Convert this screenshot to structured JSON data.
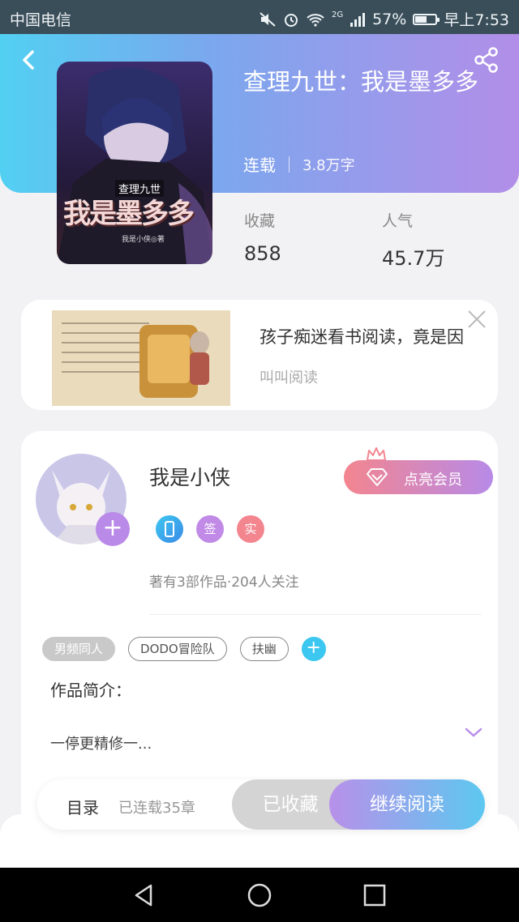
{
  "status_bar": {
    "carrier": "中国电信",
    "network": "2G",
    "battery_percent": "57%",
    "battery_level": 0.57,
    "time": "早上7:53"
  },
  "book": {
    "title": "查理九世：我是墨多多",
    "status": "连载",
    "word_count": "3.8万字",
    "stats": [
      {
        "label": "收藏",
        "value": "858"
      },
      {
        "label": "人气",
        "value": "45.7万"
      }
    ],
    "cover": {
      "small_title": "查理九世",
      "big_title": "我是墨多多",
      "author_mark": "我是小侠◎著"
    }
  },
  "ad": {
    "text": "孩子痴迷看书阅读，竟是因",
    "source": "叫叫阅读"
  },
  "author": {
    "name": "我是小侠",
    "vip_label": "点亮会员",
    "badges": [
      "签",
      "实"
    ],
    "stats": "著有3部作品·204人关注"
  },
  "tags": [
    "男频同人",
    "DODO冒险队",
    "扶幽"
  ],
  "intro": {
    "title": "作品简介：",
    "text": "一停更精修一..."
  },
  "action_bar": {
    "toc_label": "目录",
    "chapters": "已连载35章",
    "collected_label": "已收藏",
    "read_label": "继续阅读"
  },
  "colors": {
    "header_gradient_start": "#52d0f2",
    "header_gradient_end": "#b28ee8",
    "accent_purple": "#b98ae8",
    "accent_blue": "#3cc7f0",
    "vip_pink": "#f3858f"
  }
}
